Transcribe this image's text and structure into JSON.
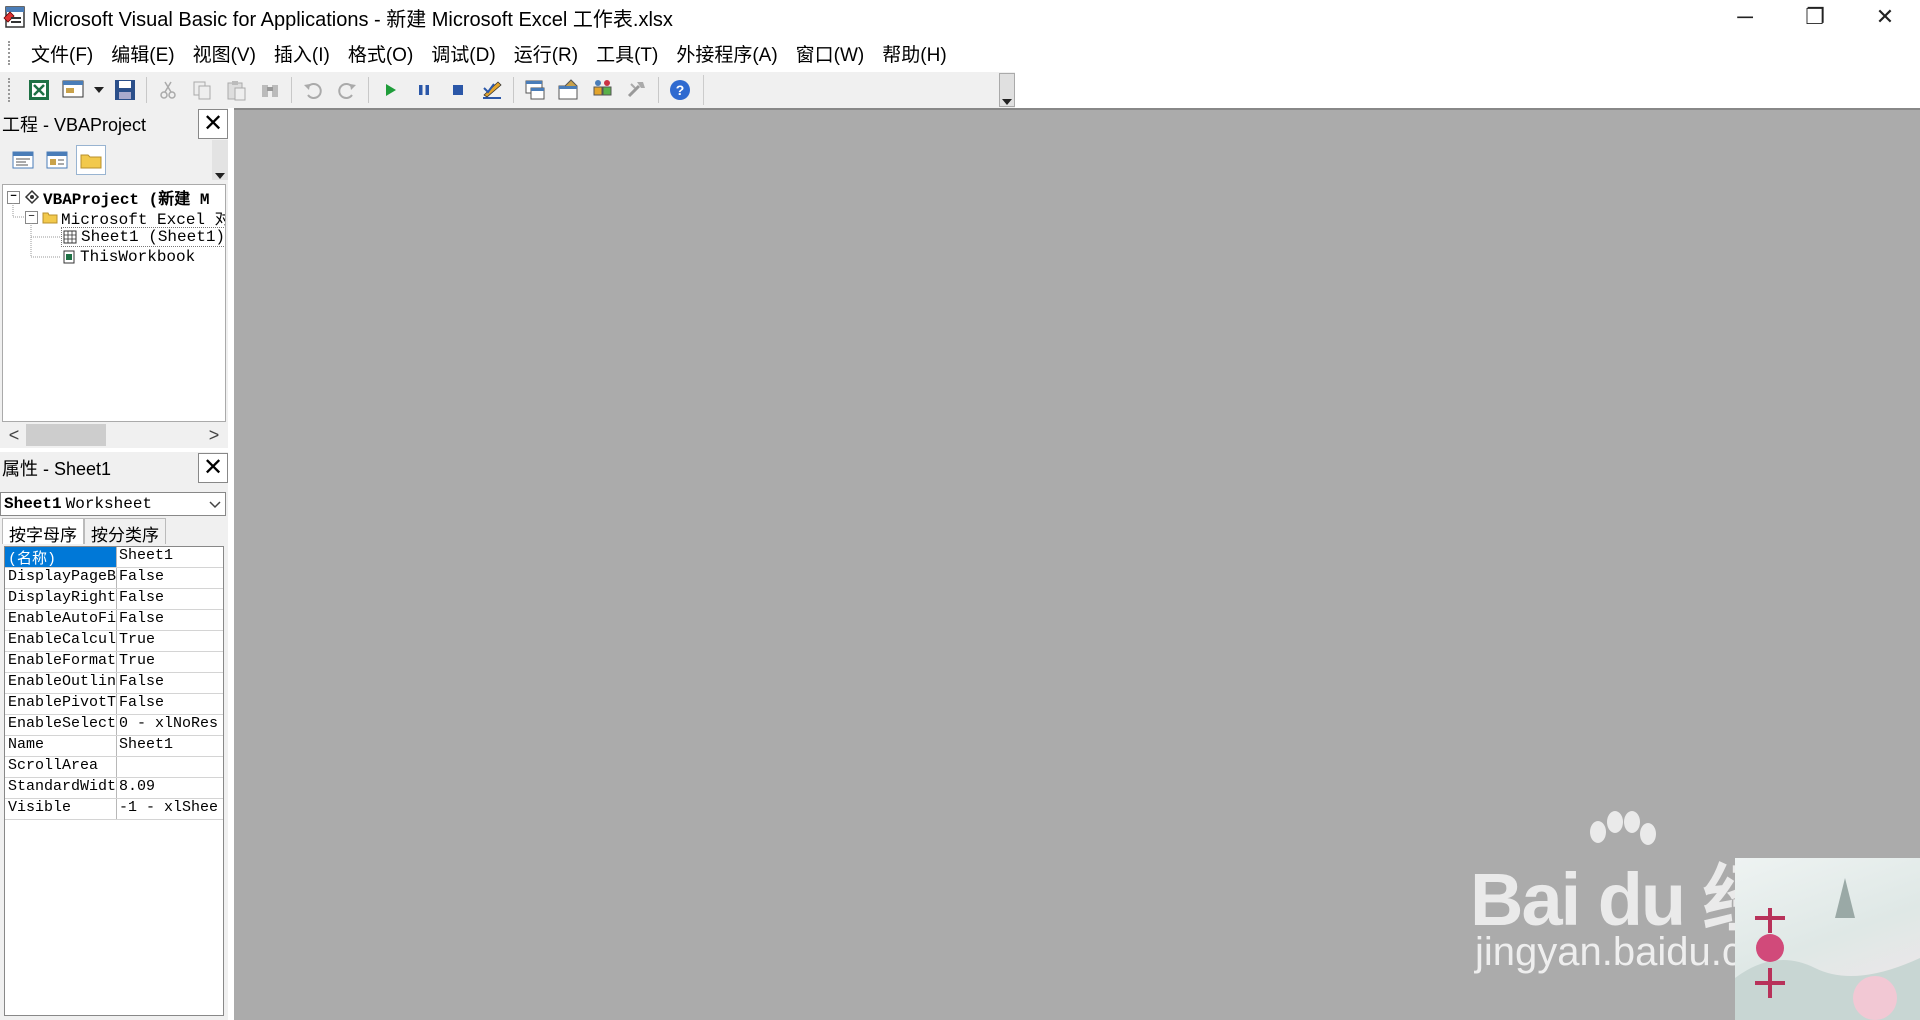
{
  "window": {
    "title": "Microsoft Visual Basic for Applications - 新建 Microsoft Excel 工作表.xlsx",
    "minimize": "─",
    "restore": "❐",
    "close": "✕"
  },
  "menu": [
    {
      "label": "文件(F)"
    },
    {
      "label": "编辑(E)"
    },
    {
      "label": "视图(V)"
    },
    {
      "label": "插入(I)"
    },
    {
      "label": "格式(O)"
    },
    {
      "label": "调试(D)"
    },
    {
      "label": "运行(R)"
    },
    {
      "label": "工具(T)"
    },
    {
      "label": "外接程序(A)"
    },
    {
      "label": "窗口(W)"
    },
    {
      "label": "帮助(H)"
    }
  ],
  "toolbar": {
    "icons": [
      "excel-icon",
      "insert-form-icon",
      "save-icon",
      "cut-icon",
      "copy-icon",
      "paste-icon",
      "find-icon",
      "undo-icon",
      "redo-icon",
      "run-icon",
      "break-icon",
      "reset-icon",
      "design-mode-icon",
      "project-explorer-icon",
      "properties-icon",
      "object-browser-icon",
      "toolbox-icon",
      "help-icon"
    ]
  },
  "project_pane": {
    "title": "工程 - VBAProject",
    "close": "✕",
    "tree": [
      {
        "label": "VBAProject (新建 M",
        "level": 0,
        "expander": "−",
        "bold": true
      },
      {
        "label": "Microsoft Excel 对",
        "level": 1,
        "expander": "−",
        "bold": false
      },
      {
        "label": "Sheet1 (Sheet1)",
        "level": 2,
        "expander": "",
        "bold": false
      },
      {
        "label": "ThisWorkbook",
        "level": 2,
        "expander": "",
        "bold": false
      }
    ],
    "scroll_left": "<",
    "scroll_right": ">"
  },
  "properties_pane": {
    "title": "属性 - Sheet1",
    "close": "✕",
    "object_name": "Sheet1",
    "object_type": "Worksheet",
    "tabs": [
      {
        "label": "按字母序"
      },
      {
        "label": "按分类序"
      }
    ],
    "rows": [
      {
        "name": "(名称)",
        "value": "Sheet1"
      },
      {
        "name": "DisplayPageB",
        "value": "False"
      },
      {
        "name": "DisplayRight",
        "value": "False"
      },
      {
        "name": "EnableAutoFi",
        "value": "False"
      },
      {
        "name": "EnableCalcul",
        "value": "True"
      },
      {
        "name": "EnableFormat",
        "value": "True"
      },
      {
        "name": "EnableOutlin",
        "value": "False"
      },
      {
        "name": "EnablePivotT",
        "value": "False"
      },
      {
        "name": "EnableSelect",
        "value": "0 - xlNoRes"
      },
      {
        "name": "Name",
        "value": "Sheet1"
      },
      {
        "name": "ScrollArea",
        "value": ""
      },
      {
        "name": "StandardWidt",
        "value": "8.09"
      },
      {
        "name": "Visible",
        "value": "-1 - xlShee"
      }
    ]
  },
  "watermark": {
    "logo": "Bai du 经验",
    "url": "jingyan.baidu.com"
  },
  "colors": {
    "mdi_background": "#ababab",
    "selection": "#0078d7",
    "pane_background": "#f0f0f0"
  }
}
